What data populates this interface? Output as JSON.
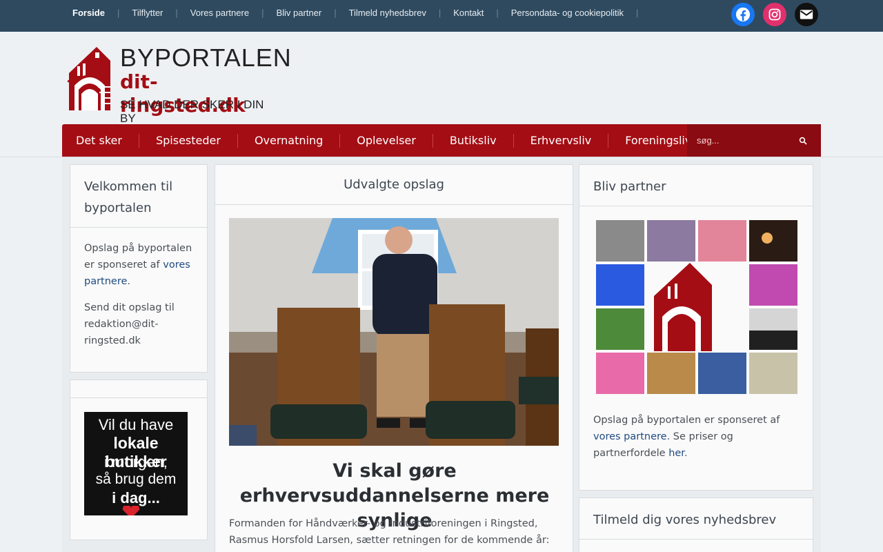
{
  "topnav": {
    "items": [
      "Forside",
      "Tilflytter",
      "Vores partnere",
      "Bliv partner",
      "Tilmeld nyhedsbrev",
      "Kontakt",
      "Persondata- og cookiepolitik"
    ]
  },
  "social": {
    "icons": [
      "facebook-icon",
      "instagram-icon",
      "mail-icon"
    ],
    "colors": [
      "#1877f2",
      "#e1306c",
      "#111111"
    ]
  },
  "logo": {
    "title": "BYPORTALEN",
    "domain": "dit-ringsted.dk",
    "tagline": "SE HVAD DER SKER I DIN BY"
  },
  "mainnav": {
    "items": [
      "Det sker",
      "Spisesteder",
      "Overnatning",
      "Oplevelser",
      "Butiksliv",
      "Erhvervsliv",
      "Foreningsliv"
    ],
    "search_placeholder": "søg..."
  },
  "left_widget": {
    "title": "Velkommen til byportalen",
    "p1_text": "Opslag på byportalen er sponseret af",
    "p1_link": "vores partnere",
    "p1_end": ".",
    "p2": "Send dit opslag til redaktion@dit-ringsted.dk"
  },
  "promo": {
    "line1": "Vil du have",
    "line2": "lokale butikker",
    "line3": "i morgen,",
    "line4": "så brug dem",
    "line5": "i dag..."
  },
  "center": {
    "title": "Udvalgte opslag",
    "headline": "Vi skal gøre erhvervsuddannelserne mere synlige",
    "excerpt": "Formanden for Håndværker- og Industriforeningen i Ringsted, Rasmus Horsfold Larsen, sætter retningen for de kommende år: Tættere"
  },
  "right_widget": {
    "title": "Bliv partner",
    "text1": "Opslag på byportalen er sponseret af",
    "link1": "vores partnere",
    "text2": ". Se priser og partnerfordele",
    "link2": "her",
    "text3": "."
  },
  "newsletter_widget": {
    "title": "Tilmeld dig vores nyhedsbrev"
  },
  "colors": {
    "topbar": "#2f4a5f",
    "brand_red": "#a40d14",
    "link": "#1f4a80"
  }
}
